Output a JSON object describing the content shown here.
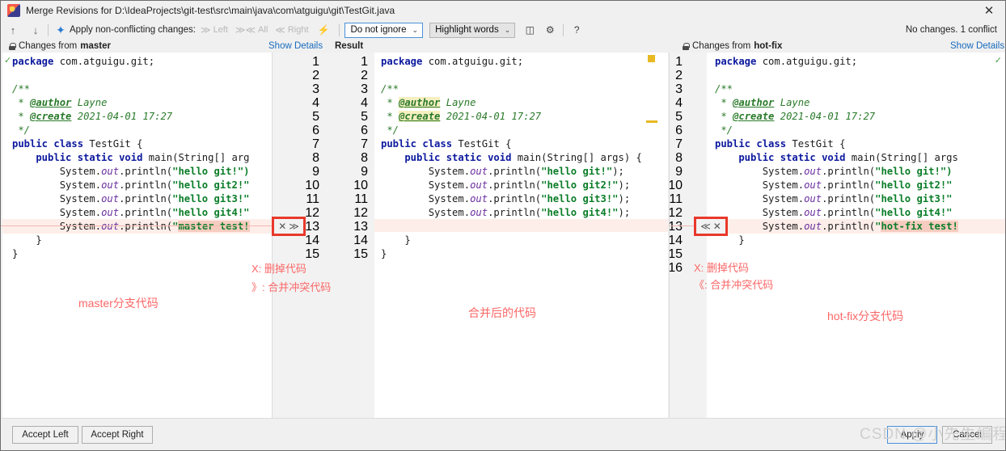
{
  "window": {
    "title": "Merge Revisions for D:\\IdeaProjects\\git-test\\src\\main\\java\\com\\atguigu\\git\\TestGit.java",
    "close_label": "✕",
    "app_icon": "intellij-idea-icon"
  },
  "toolbar": {
    "prev_label": "↑",
    "next_label": "↓",
    "magic_label": "✦",
    "apply_label": "Apply non-conflicting changes:",
    "left_label": "Left",
    "left_glyph": "≫",
    "all_label": "All",
    "all_glyph": "≫≪",
    "right_label": "Right",
    "right_glyph": "≪",
    "wand_glyph": "⚡",
    "ignore_select": "Do not ignore",
    "highlight_select": "Highlight words",
    "caret": "⌄",
    "columns_glyph": "◫",
    "settings_glyph": "⚙",
    "help_glyph": "?",
    "status": "No changes. 1 conflict"
  },
  "headers": {
    "left": {
      "prefix": "Changes from ",
      "branch": "master"
    },
    "center_details": "Show Details",
    "center_result": "Result",
    "right": {
      "prefix": "Changes from ",
      "branch": "hot-fix"
    },
    "right_details": "Show Details"
  },
  "left_pane": {
    "title": "master",
    "line_numbers": [],
    "code": [
      [
        {
          "t": "package ",
          "c": "kw"
        },
        {
          "t": "com.atguigu.git;",
          "c": "plain"
        }
      ],
      [],
      [
        {
          "t": "/**",
          "c": "cmt-b"
        }
      ],
      [
        {
          "t": " * ",
          "c": "cmt-b"
        },
        {
          "t": "@author",
          "c": "tag"
        },
        {
          "t": " Layne",
          "c": "cmt-b"
        }
      ],
      [
        {
          "t": " * ",
          "c": "cmt-b"
        },
        {
          "t": "@create",
          "c": "tag"
        },
        {
          "t": " 2021-04-01 17:27",
          "c": "cmt-b"
        }
      ],
      [
        {
          "t": " */",
          "c": "cmt-b"
        }
      ],
      [
        {
          "t": "public class ",
          "c": "kw"
        },
        {
          "t": "TestGit {",
          "c": "plain"
        }
      ],
      [
        {
          "t": "    public static void ",
          "c": "kw"
        },
        {
          "t": "main(String[] arg",
          "c": "plain"
        }
      ],
      [
        {
          "t": "        System.",
          "c": "plain"
        },
        {
          "t": "out",
          "c": "fld"
        },
        {
          "t": ".println(",
          "c": "plain"
        },
        {
          "t": "\"hello git!\")",
          "c": "str"
        }
      ],
      [
        {
          "t": "        System.",
          "c": "plain"
        },
        {
          "t": "out",
          "c": "fld"
        },
        {
          "t": ".println(",
          "c": "plain"
        },
        {
          "t": "\"hello git2!\"",
          "c": "str"
        }
      ],
      [
        {
          "t": "        System.",
          "c": "plain"
        },
        {
          "t": "out",
          "c": "fld"
        },
        {
          "t": ".println(",
          "c": "plain"
        },
        {
          "t": "\"hello git3!\"",
          "c": "str"
        }
      ],
      [
        {
          "t": "        System.",
          "c": "plain"
        },
        {
          "t": "out",
          "c": "fld"
        },
        {
          "t": ".println(",
          "c": "plain"
        },
        {
          "t": "\"hello git4!\"",
          "c": "str"
        }
      ],
      [
        {
          "t": "        System.",
          "c": "plain"
        },
        {
          "t": "out",
          "c": "fld"
        },
        {
          "t": ".println(",
          "c": "plain"
        },
        {
          "t": "\"",
          "c": "str"
        },
        {
          "t": "master test!",
          "c": "str hl-conf"
        }
      ],
      [
        {
          "t": "    }",
          "c": "plain"
        }
      ],
      [
        {
          "t": "}",
          "c": "plain"
        }
      ]
    ]
  },
  "result_pane": {
    "line_numbers_left": [
      "1",
      "2",
      "3",
      "4",
      "5",
      "6",
      "7",
      "8",
      "9",
      "10",
      "11",
      "12",
      "13",
      "14",
      "15"
    ],
    "line_numbers_right": [
      "1",
      "2",
      "3",
      "4",
      "5",
      "6",
      "7",
      "8",
      "9",
      "10",
      "11",
      "12",
      "13",
      "14",
      "15"
    ],
    "code": [
      [
        {
          "t": "package ",
          "c": "kw"
        },
        {
          "t": "com.atguigu.git;",
          "c": "plain"
        }
      ],
      [],
      [
        {
          "t": "/**",
          "c": "cmt-b"
        }
      ],
      [
        {
          "t": " * ",
          "c": "cmt-b"
        },
        {
          "t": "@author",
          "c": "tag tag-hl"
        },
        {
          "t": " Layne",
          "c": "cmt-b"
        }
      ],
      [
        {
          "t": " * ",
          "c": "cmt-b"
        },
        {
          "t": "@create",
          "c": "tag tag-hl"
        },
        {
          "t": " 2021-04-01 17:27",
          "c": "cmt-b"
        }
      ],
      [
        {
          "t": " */",
          "c": "cmt-b"
        }
      ],
      [
        {
          "t": "public class ",
          "c": "kw"
        },
        {
          "t": "TestGit {",
          "c": "plain"
        }
      ],
      [
        {
          "t": "    public static void ",
          "c": "kw"
        },
        {
          "t": "main(String[] args) {",
          "c": "plain"
        }
      ],
      [
        {
          "t": "        System.",
          "c": "plain"
        },
        {
          "t": "out",
          "c": "fld"
        },
        {
          "t": ".println(",
          "c": "plain"
        },
        {
          "t": "\"hello git!\"",
          "c": "str"
        },
        {
          "t": ");",
          "c": "plain"
        }
      ],
      [
        {
          "t": "        System.",
          "c": "plain"
        },
        {
          "t": "out",
          "c": "fld"
        },
        {
          "t": ".println(",
          "c": "plain"
        },
        {
          "t": "\"hello git2!\"",
          "c": "str"
        },
        {
          "t": ");",
          "c": "plain"
        }
      ],
      [
        {
          "t": "        System.",
          "c": "plain"
        },
        {
          "t": "out",
          "c": "fld"
        },
        {
          "t": ".println(",
          "c": "plain"
        },
        {
          "t": "\"hello git3!\"",
          "c": "str"
        },
        {
          "t": ");",
          "c": "plain"
        }
      ],
      [
        {
          "t": "        System.",
          "c": "plain"
        },
        {
          "t": "out",
          "c": "fld"
        },
        {
          "t": ".println(",
          "c": "plain"
        },
        {
          "t": "\"hello git4!\"",
          "c": "str"
        },
        {
          "t": ");",
          "c": "plain"
        }
      ],
      [],
      [
        {
          "t": "    }",
          "c": "plain"
        }
      ],
      [
        {
          "t": "}",
          "c": "plain"
        }
      ]
    ]
  },
  "right_pane": {
    "title": "hot-fix",
    "line_numbers": [
      "1",
      "2",
      "3",
      "4",
      "5",
      "6",
      "7",
      "8",
      "9",
      "10",
      "11",
      "12",
      "13",
      "14",
      "15",
      "16"
    ],
    "code": [
      [
        {
          "t": "package ",
          "c": "kw"
        },
        {
          "t": "com.atguigu.git;",
          "c": "plain"
        }
      ],
      [],
      [
        {
          "t": "/**",
          "c": "cmt-b"
        }
      ],
      [
        {
          "t": " * ",
          "c": "cmt-b"
        },
        {
          "t": "@author",
          "c": "tag"
        },
        {
          "t": " Layne",
          "c": "cmt-b"
        }
      ],
      [
        {
          "t": " * ",
          "c": "cmt-b"
        },
        {
          "t": "@create",
          "c": "tag"
        },
        {
          "t": " 2021-04-01 17:27",
          "c": "cmt-b"
        }
      ],
      [
        {
          "t": " */",
          "c": "cmt-b"
        }
      ],
      [
        {
          "t": "public class ",
          "c": "kw"
        },
        {
          "t": "TestGit {",
          "c": "plain"
        }
      ],
      [
        {
          "t": "    public static void ",
          "c": "kw"
        },
        {
          "t": "main(String[] args",
          "c": "plain"
        }
      ],
      [
        {
          "t": "        System.",
          "c": "plain"
        },
        {
          "t": "out",
          "c": "fld"
        },
        {
          "t": ".println(",
          "c": "plain"
        },
        {
          "t": "\"hello git!\")",
          "c": "str"
        }
      ],
      [
        {
          "t": "        System.",
          "c": "plain"
        },
        {
          "t": "out",
          "c": "fld"
        },
        {
          "t": ".println(",
          "c": "plain"
        },
        {
          "t": "\"hello git2!\"",
          "c": "str"
        }
      ],
      [
        {
          "t": "        System.",
          "c": "plain"
        },
        {
          "t": "out",
          "c": "fld"
        },
        {
          "t": ".println(",
          "c": "plain"
        },
        {
          "t": "\"hello git3!\"",
          "c": "str"
        }
      ],
      [
        {
          "t": "        System.",
          "c": "plain"
        },
        {
          "t": "out",
          "c": "fld"
        },
        {
          "t": ".println(",
          "c": "plain"
        },
        {
          "t": "\"hello git4!\"",
          "c": "str"
        }
      ],
      [
        {
          "t": "        System.",
          "c": "plain"
        },
        {
          "t": "out",
          "c": "fld"
        },
        {
          "t": ".println(",
          "c": "plain"
        },
        {
          "t": "\"",
          "c": "str"
        },
        {
          "t": "hot-fix test!",
          "c": "str hl-conf"
        }
      ],
      [
        {
          "t": "    }",
          "c": "plain"
        }
      ],
      [],
      []
    ]
  },
  "conflict_badges": {
    "left": {
      "x_glyph": "✕",
      "arrow_glyph": "≫"
    },
    "right": {
      "arrow_glyph": "≪",
      "x_glyph": "✕"
    }
  },
  "annotations": {
    "center_x": "X:  删掉代码",
    "center_merge": "》:  合并冲突代码",
    "right_x": "X:  删掉代码",
    "right_merge": "《:  合并冲突代码",
    "left_branch": "master分支代码",
    "center_branch": "合并后的代码",
    "right_branch": "hot-fix分支代码"
  },
  "buttons": {
    "accept_left": "Accept Left",
    "accept_right": "Accept Right",
    "apply": "Apply",
    "cancel": "Cancel"
  },
  "watermark": "CSDN @小先生编程",
  "colors": {
    "accent_blue": "#4a90d9",
    "link": "#176bbd",
    "conflict_red": "#e8392c",
    "conflict_row": "#fbe4e0",
    "annotation_red": "#fb6767",
    "keyword": "#0c199e",
    "string": "#0a7d28",
    "comment": "#2a7a2a",
    "field": "#6b2fa0",
    "marker_yellow": "#e8b923"
  }
}
